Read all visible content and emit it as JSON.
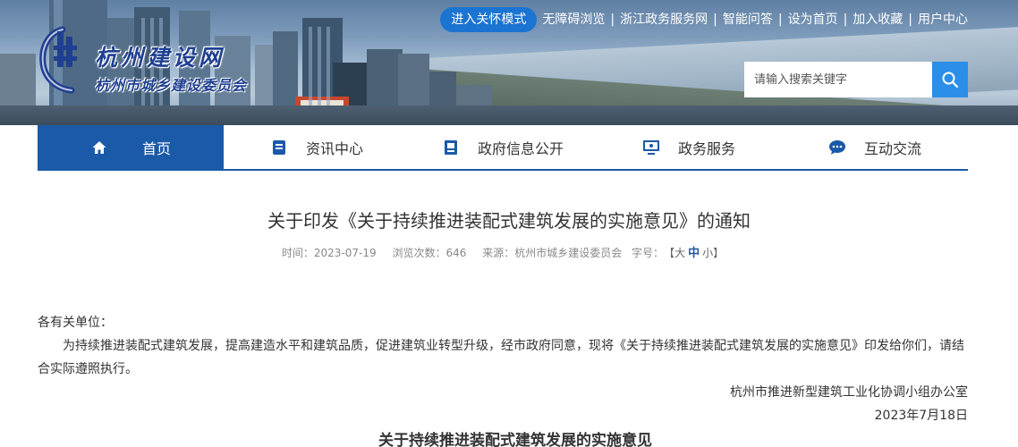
{
  "site": {
    "name": "杭州建设网",
    "subname": "杭州市城乡建设委员会"
  },
  "toplinks": {
    "care_mode": "进入关怀模式",
    "items": [
      "无障碍浏览",
      "浙江政务服务网",
      "智能问答",
      "设为首页",
      "加入收藏",
      "用户中心"
    ]
  },
  "search": {
    "placeholder": "请输入搜索关键字",
    "icon": "search-icon"
  },
  "nav": {
    "items": [
      {
        "label": "首页",
        "icon": "home-icon",
        "active": true
      },
      {
        "label": "资讯中心",
        "icon": "news-icon"
      },
      {
        "label": "政府信息公开",
        "icon": "document-icon"
      },
      {
        "label": "政务服务",
        "icon": "monitor-icon"
      },
      {
        "label": "互动交流",
        "icon": "chat-icon"
      }
    ]
  },
  "article": {
    "title": "关于印发《关于持续推进装配式建筑发展的实施意见》的通知",
    "meta": {
      "time": "时间：2023-07-19",
      "views": "浏览次数：646",
      "source": "来源：杭州市城乡建设委员会",
      "fontsize_label": "字号：",
      "fontsize_open": "【",
      "fontsize_large": "大",
      "fontsize_medium": "中",
      "fontsize_small": "小",
      "fontsize_close": "】"
    },
    "greeting": "各有关单位：",
    "paragraph": "为持续推进装配式建筑发展，提高建造水平和建筑品质，促进建筑业转型升级，经市政府同意，现将《关于持续推进装配式建筑发展的实施意见》印发给你们，请结合实际遵照执行。",
    "signature_org": "杭州市推进新型建筑工业化协调小组办公室",
    "signature_date": "2023年7月18日",
    "subtitle": "关于持续推进装配式建筑发展的实施意见"
  },
  "colors": {
    "primary": "#1a5aa8",
    "care_button": "#1b74d2",
    "search_button": "#2b8ee8"
  }
}
